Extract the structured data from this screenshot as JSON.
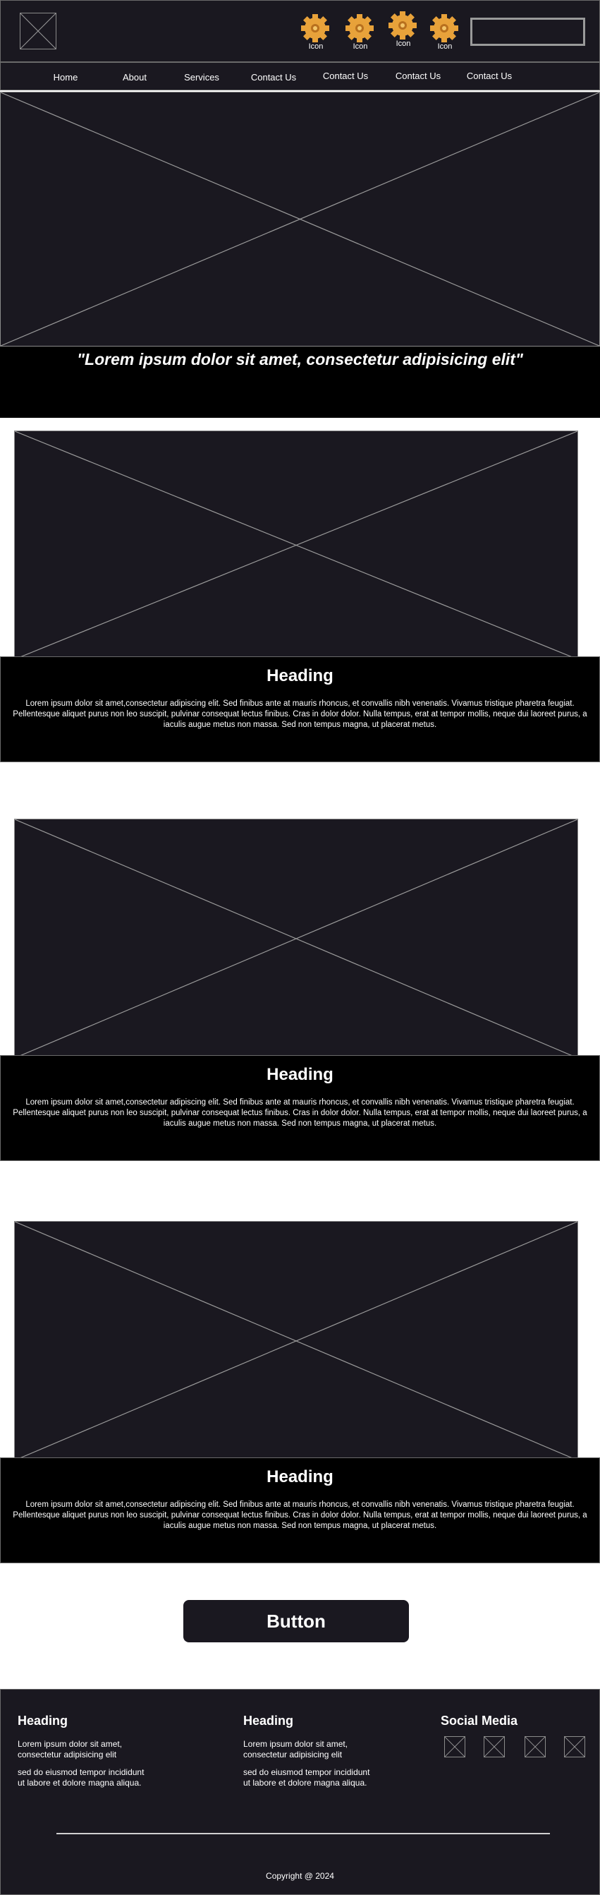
{
  "header": {
    "icons": [
      {
        "label": "Icon",
        "icon": "gear-icon"
      },
      {
        "label": "Icon",
        "icon": "gear-icon"
      },
      {
        "label": "Icon",
        "icon": "gear-icon"
      },
      {
        "label": "Icon",
        "icon": "gear-icon"
      }
    ],
    "search_value": ""
  },
  "nav": {
    "items": [
      "Home",
      "About",
      "Services",
      "Contact Us",
      "Contact Us",
      "Contact Us",
      "Contact Us"
    ]
  },
  "hero": {
    "quote": "\"Lorem ipsum dolor sit amet, consectetur adipisicing elit\""
  },
  "sections": [
    {
      "heading": "Heading",
      "text": "Lorem ipsum dolor sit amet,consectetur adipiscing elit. Sed finibus ante at mauris rhoncus, et convallis nibh venenatis. Vivamus tristique pharetra feugiat. Pellentesque aliquet purus non leo suscipit, pulvinar consequat lectus finibus. Cras in dolor dolor. Nulla tempus, erat at tempor mollis, neque dui laoreet purus, a iaculis augue metus non massa. Sed non tempus magna, ut placerat metus."
    },
    {
      "heading": "Heading",
      "text": "Lorem ipsum dolor sit amet,consectetur adipiscing elit. Sed finibus ante at mauris rhoncus, et convallis nibh venenatis. Vivamus tristique pharetra feugiat. Pellentesque aliquet purus non leo suscipit, pulvinar consequat lectus finibus. Cras in dolor dolor. Nulla tempus, erat at tempor mollis, neque dui laoreet purus, a iaculis augue metus non massa. Sed non tempus magna, ut placerat metus."
    },
    {
      "heading": "Heading",
      "text": "Lorem ipsum dolor sit amet,consectetur adipiscing elit. Sed finibus ante at mauris rhoncus, et convallis nibh venenatis. Vivamus tristique pharetra feugiat. Pellentesque aliquet purus non leo suscipit, pulvinar consequat lectus finibus. Cras in dolor dolor. Nulla tempus, erat at tempor mollis, neque dui laoreet purus, a iaculis augue metus non massa. Sed non tempus magna, ut placerat metus."
    }
  ],
  "button": {
    "label": "Button"
  },
  "footer": {
    "col1": {
      "heading": "Heading",
      "line1": "Lorem ipsum dolor sit amet,",
      "line2": "consectetur adipisicing elit",
      "line3": "sed do eiusmod tempor incididunt",
      "line4": "ut labore et dolore magna aliqua."
    },
    "col2": {
      "heading": "Heading",
      "line1": "Lorem ipsum dolor sit amet,",
      "line2": "consectetur adipisicing elit",
      "line3": "sed do eiusmod tempor incididunt",
      "line4": "ut labore et dolore magna aliqua."
    },
    "social": {
      "heading": "Social Media"
    },
    "copyright": "Copyright @ 2024"
  },
  "colors": {
    "dark_bg": "#1a1820",
    "black_bg": "#000000",
    "placeholder_line": "#9a9a9a",
    "gear_gold": "#e8a23a"
  }
}
